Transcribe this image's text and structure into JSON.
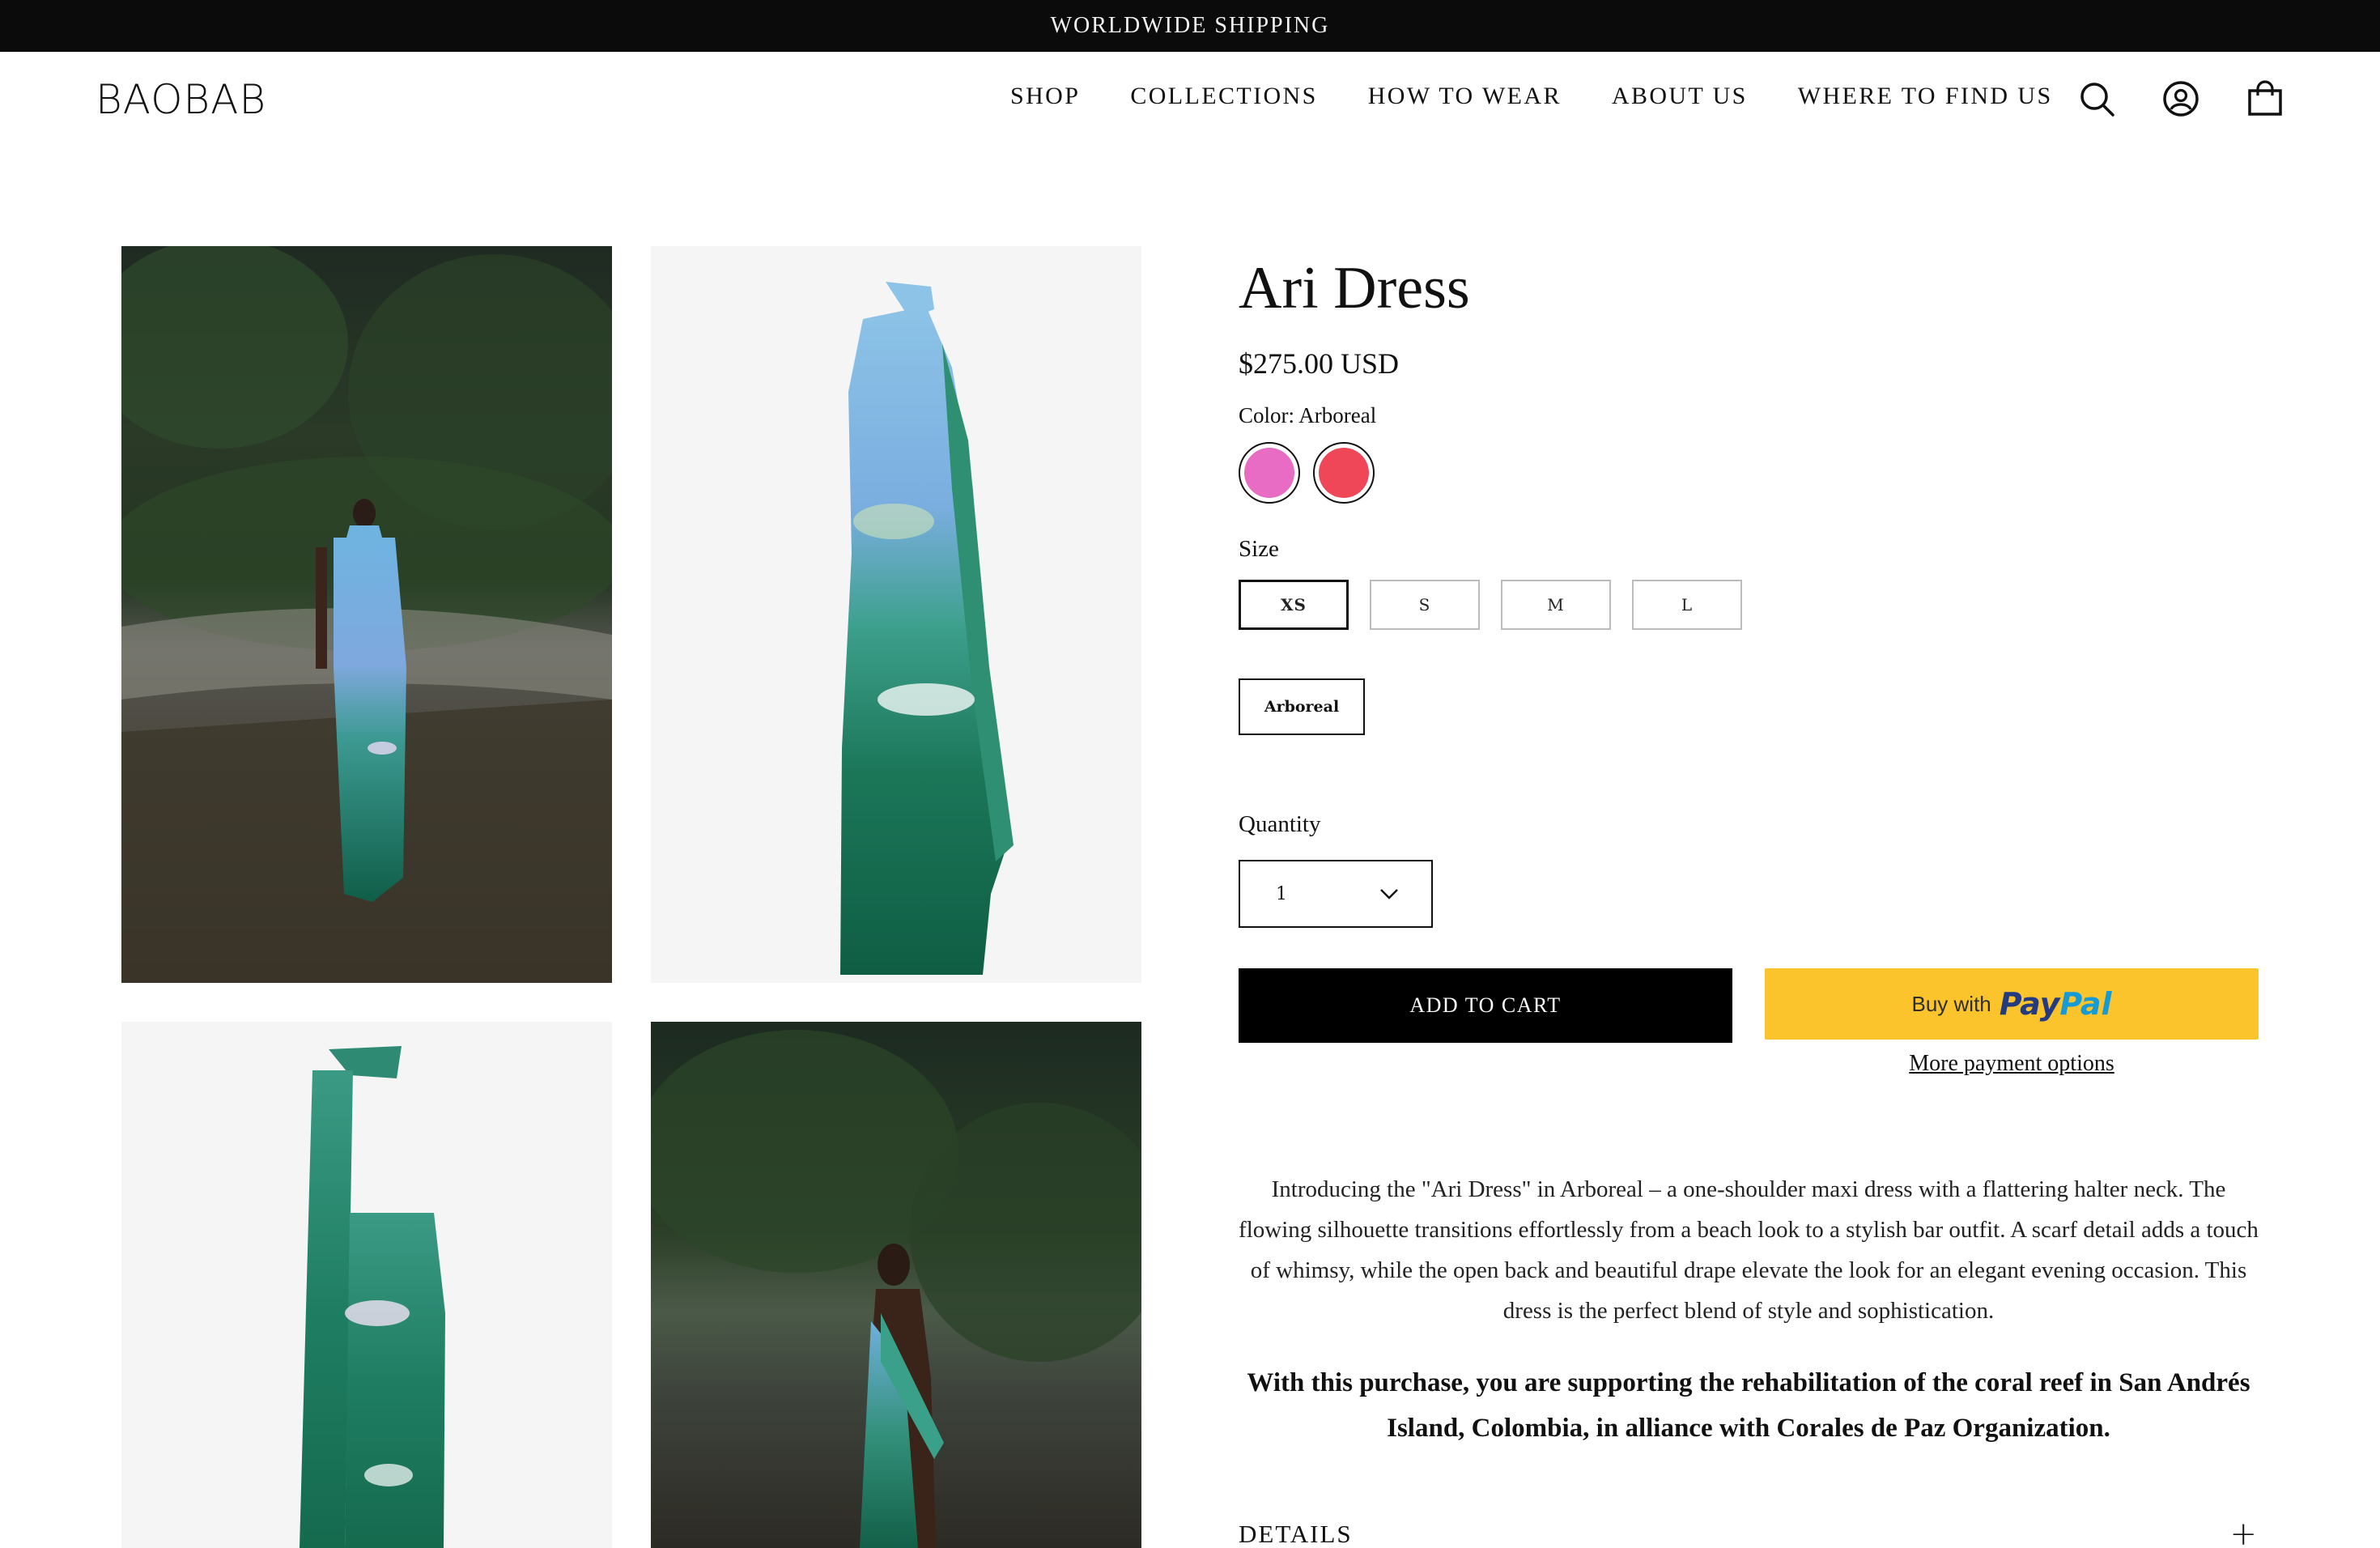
{
  "announcement": "WORLDWIDE SHIPPING",
  "header": {
    "logo": "BAOBAB",
    "nav": [
      "SHOP",
      "COLLECTIONS",
      "HOW TO WEAR",
      "ABOUT US",
      "WHERE TO FIND US"
    ],
    "icons": [
      "search-icon",
      "account-icon",
      "cart-icon"
    ]
  },
  "gallery": {
    "images": [
      "model-forest-front",
      "dress-product-front",
      "dress-product-back",
      "model-forest-back"
    ]
  },
  "product": {
    "title": "Ari Dress",
    "price": "$275.00 USD",
    "color_label": "Color: Arboreal",
    "swatches": [
      {
        "name": "pink",
        "color": "#e86cc3"
      },
      {
        "name": "red",
        "color": "#f04758"
      }
    ],
    "size_label": "Size",
    "sizes": [
      "XS",
      "S",
      "M",
      "L"
    ],
    "selected_size": "XS",
    "variant": "Arboreal",
    "quantity_label": "Quantity",
    "quantity_value": "1",
    "add_to_cart": "ADD TO CART",
    "paypal_prefix": "Buy with",
    "paypal_brand_a": "Pay",
    "paypal_brand_b": "Pal",
    "more_payment": "More payment options",
    "description": "Introducing the \"Ari Dress\" in Arboreal – a one-shoulder maxi dress with a flattering halter neck. The flowing silhouette transitions effortlessly from a beach look to a stylish bar outfit. A scarf detail adds a touch of whimsy, while the open back and beautiful drape elevate the look for an elegant evening occasion. This dress is the perfect blend of style and sophistication.",
    "support_note": "With this purchase, you are supporting the rehabilitation of the coral reef in San Andrés Island, Colombia, in alliance with Corales de Paz Organization.",
    "details_label": "DETAILS"
  },
  "colors": {
    "announcement_bg": "#0b0b0b",
    "cart_button": "#000000",
    "paypal_yellow": "#fbc42c"
  }
}
